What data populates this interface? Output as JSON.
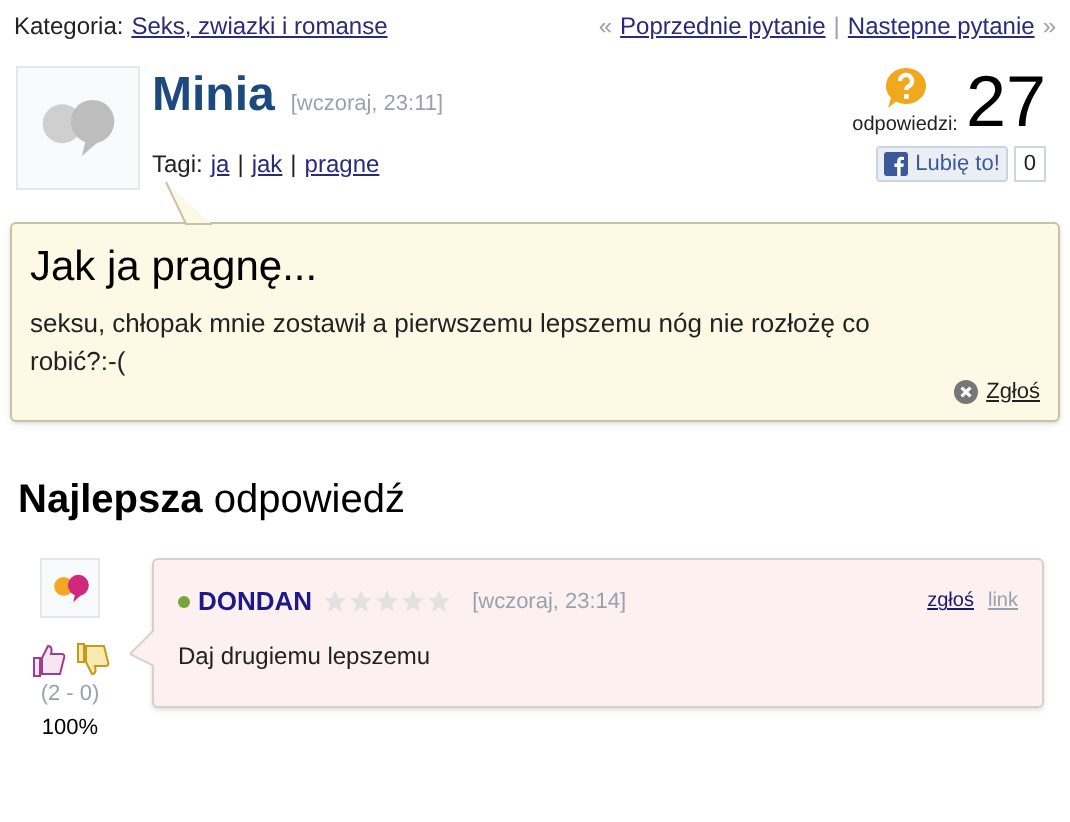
{
  "category": {
    "label": "Kategoria:",
    "link": "Seks, zwiazki i romanse"
  },
  "nav": {
    "prev_mark": "«",
    "prev": "Poprzednie pytanie",
    "separator": "|",
    "next": "Nastepne pytanie",
    "next_mark": "»"
  },
  "question": {
    "author": "Minia",
    "time": "[wczoraj, 23:11]",
    "tags_label": "Tagi:",
    "tag_separator": "|",
    "tags": [
      "ja",
      "jak",
      "pragne"
    ],
    "answers_label": "odpowiedzi:",
    "answers_count": "27",
    "like_label": "Lubię to!",
    "like_count": "0",
    "title": "Jak ja pragnę...",
    "body": "seksu, chłopak mnie zostawił a pierwszemu lepszemu nóg nie rozłożę co robić?:-(",
    "report": "Zgłoś"
  },
  "best_answer": {
    "heading": "**Najlepsza** odpowiedź",
    "author": "DONDAN",
    "online": true,
    "stars": 0,
    "time": "[wczoraj, 23:14]",
    "report": "zgłoś",
    "link": "link",
    "body": "Daj drugiemu lepszemu",
    "votes": "(2 - 0)",
    "percent": "100%"
  }
}
